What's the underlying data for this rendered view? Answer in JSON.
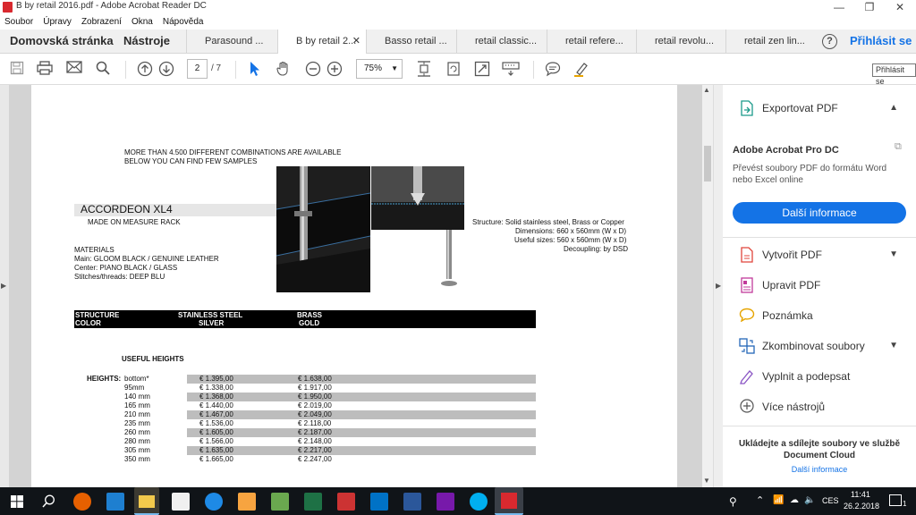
{
  "window": {
    "title": "B by retail 2016.pdf - Adobe Acrobat Reader DC",
    "minimize": "—",
    "maximize": "❐",
    "close": "✕"
  },
  "menu": [
    "Soubor",
    "Úpravy",
    "Zobrazení",
    "Okna",
    "Nápověda"
  ],
  "tabs": {
    "home": "Domovská stránka",
    "tools": "Nástroje",
    "documents": [
      {
        "label": "Parasound ...",
        "active": false
      },
      {
        "label": "B by retail 2...",
        "active": true
      },
      {
        "label": "Basso retail ...",
        "active": false
      },
      {
        "label": "retail classic...",
        "active": false
      },
      {
        "label": "retail refere...",
        "active": false
      },
      {
        "label": "retail revolu...",
        "active": false
      },
      {
        "label": "retail zen lin...",
        "active": false
      }
    ],
    "help": "?",
    "signin": "Přihlásit se"
  },
  "toolbar": {
    "page_current": "2",
    "page_total": "/ 7",
    "zoom": "75%",
    "tooltip": "Přihlásit se",
    "icons": [
      "save-icon",
      "print-icon",
      "email-icon",
      "search-icon",
      "prev-page-icon",
      "next-page-icon",
      "select-cursor-icon",
      "hand-icon",
      "zoom-out-icon",
      "zoom-in-icon",
      "fit-page-icon",
      "rotate-icon",
      "fullscreen-icon",
      "keyboard-icon",
      "comment-icon",
      "highlight-icon"
    ]
  },
  "pdf": {
    "intro_line1": "MORE THAN 4.500 DIFFERENT COMBINATIONS ARE AVAILABLE",
    "intro_line2": "BELOW YOU CAN FIND FEW SAMPLES",
    "product_name": "ACCORDEON XL4",
    "product_sub": "MADE ON MEASURE RACK",
    "materials_title": "MATERIALS",
    "materials_main": "Main: GLOOM BLACK / GENUINE LEATHER",
    "materials_center": "Center: PIANO BLACK / GLASS",
    "materials_stitches": "Stitches/threads: DEEP BLU",
    "spec_structure": "Structure: Solid stainless steel, Brass or Copper",
    "spec_dimensions": "Dimensions: 660 x 560mm (W x D)",
    "spec_useful": "Useful sizes: 560 x 560mm (W x D)",
    "spec_decoupling": "Decoupling: by DSD",
    "bar_structure": "STRUCTURE",
    "bar_color": "COLOR",
    "bar_col1_top": "STAINLESS STEEL",
    "bar_col1_bottom": "SILVER",
    "bar_col2_top": "BRASS",
    "bar_col2_bottom": "GOLD",
    "useful_heights_title": "USEFUL HEIGHTS",
    "heights_label": "HEIGHTS:",
    "heights": [
      {
        "height": "bottom*",
        "steel": "€ 1.395,00",
        "brass": "€ 1.638,00"
      },
      {
        "height": "95mm",
        "steel": "€ 1.338,00",
        "brass": "€ 1.917,00"
      },
      {
        "height": "140 mm",
        "steel": "€ 1.368,00",
        "brass": "€ 1.950,00"
      },
      {
        "height": "165 mm",
        "steel": "€ 1.440,00",
        "brass": "€ 2.019,00"
      },
      {
        "height": "210 mm",
        "steel": "€ 1.467,00",
        "brass": "€ 2.049,00"
      },
      {
        "height": "235 mm",
        "steel": "€ 1.536,00",
        "brass": "€ 2.118,00"
      },
      {
        "height": "260 mm",
        "steel": "€ 1.605,00",
        "brass": "€ 2.187,00"
      },
      {
        "height": "280 mm",
        "steel": "€ 1.566,00",
        "brass": "€ 2.148,00"
      },
      {
        "height": "305 mm",
        "steel": "€ 1.635,00",
        "brass": "€ 2.217,00"
      },
      {
        "height": "350 mm",
        "steel": "€ 1.665,00",
        "brass": "€ 2.247,00"
      }
    ]
  },
  "rightpane": {
    "export": "Exportovat PDF",
    "promo_title": "Adobe Acrobat Pro DC",
    "promo_text": "Převést soubory PDF do formátu Word nebo Excel online",
    "promo_button": "Další informace",
    "tools": [
      {
        "label": "Vytvořit PDF",
        "icon": "create-pdf-icon",
        "chevron": true
      },
      {
        "label": "Upravit PDF",
        "icon": "edit-pdf-icon",
        "chevron": false
      },
      {
        "label": "Poznámka",
        "icon": "comment-icon",
        "chevron": false
      },
      {
        "label": "Zkombinovat soubory",
        "icon": "combine-icon",
        "chevron": true
      },
      {
        "label": "Vyplnit a podepsat",
        "icon": "sign-icon",
        "chevron": false
      },
      {
        "label": "Více nástrojů",
        "icon": "more-tools-icon",
        "chevron": false
      }
    ],
    "footer_text": "Ukládejte a sdílejte soubory ve službě Document Cloud",
    "footer_link": "Další informace"
  },
  "taskbar": {
    "lang": "CES",
    "time": "11:41",
    "date": "26.2.2018",
    "notification_count": "1"
  },
  "colors": {
    "accent": "#1473e6",
    "acrobat_red": "#d8292f"
  }
}
